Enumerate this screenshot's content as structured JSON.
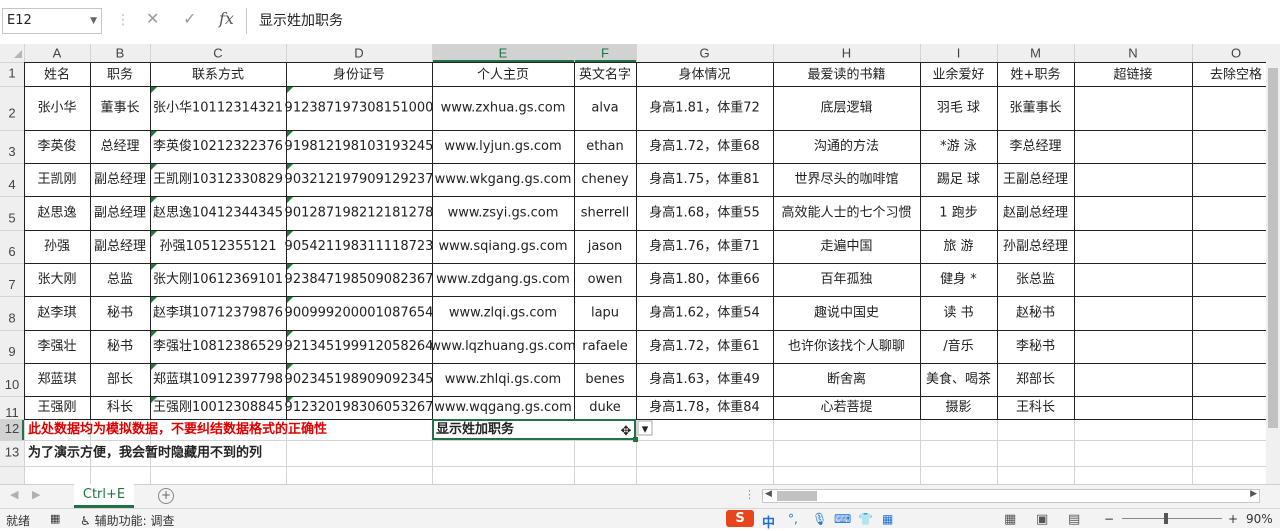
{
  "formula_bar": {
    "name_box": "E12",
    "cancel_symbol": "✕",
    "enter_symbol": "✓",
    "fx_symbol": "fx",
    "formula": "显示姓加职务"
  },
  "columns": [
    "A",
    "B",
    "C",
    "D",
    "E",
    "F",
    "G",
    "H",
    "I",
    "M",
    "N",
    "O"
  ],
  "selected_column": "E",
  "rows": [
    "1",
    "2",
    "3",
    "4",
    "5",
    "6",
    "7",
    "8",
    "9",
    "10",
    "11",
    "12",
    "13"
  ],
  "selected_row": "12",
  "headers": [
    "姓名",
    "职务",
    "联系方式",
    "身份证号",
    "个人主页",
    "英文名字",
    "身体情况",
    "最爱读的书籍",
    "业余爱好",
    "姓+职务",
    "超链接",
    "去除空格"
  ],
  "table_rows": [
    [
      "张小华",
      "董事长",
      "张小华10112314321",
      "912387197308151000",
      "www.zxhua.gs.com",
      "alva",
      "身高1.81，体重72",
      "底层逻辑",
      "羽毛  球",
      "张董事长",
      "",
      ""
    ],
    [
      "李英俊",
      "总经理",
      "李英俊10212322376",
      "919812198103193245",
      "www.lyjun.gs.com",
      "ethan",
      "身高1.72，体重68",
      "沟通的方法",
      "*游 泳",
      "李总经理",
      "",
      ""
    ],
    [
      "王凯刚",
      "副总经理",
      "王凯刚10312330829",
      "903212197909129237",
      "www.wkgang.gs.com",
      "cheney",
      "身高1.75，体重81",
      "世界尽头的咖啡馆",
      "踢足  球",
      "王副总经理",
      "",
      ""
    ],
    [
      "赵思逸",
      "副总经理",
      "赵思逸10412344345",
      "901287198212181278",
      "www.zsyi.gs.com",
      "sherrell",
      "身高1.68，体重55",
      "高效能人士的七个习惯",
      "1 跑步",
      "赵副总经理",
      "",
      ""
    ],
    [
      "孙强",
      "副总经理",
      "孙强10512355121",
      "905421198311118723",
      "www.sqiang.gs.com",
      "jason",
      "身高1.76，体重71",
      "走遍中国",
      "旅    游",
      "孙副总经理",
      "",
      ""
    ],
    [
      "张大刚",
      "总监",
      "张大刚10612369101",
      "923847198509082367",
      "www.zdgang.gs.com",
      "owen",
      "身高1.80，体重66",
      "百年孤独",
      "健身 *",
      "张总监",
      "",
      ""
    ],
    [
      "赵李琪",
      "秘书",
      "赵李琪10712379876",
      "900999200001087654",
      "www.zlqi.gs.com",
      "lapu",
      "身高1.62，体重54",
      "趣说中国史",
      "读 书",
      "赵秘书",
      "",
      ""
    ],
    [
      "李强壮",
      "秘书",
      "李强壮10812386529",
      "921345199912058264",
      "www.lqzhuang.gs.com",
      "rafaele",
      "身高1.72，体重61",
      "也许你该找个人聊聊",
      "/音乐",
      "李秘书",
      "",
      ""
    ],
    [
      "郑蓝琪",
      "部长",
      "郑蓝琪10912397798",
      "902345198909092345",
      "www.zhlqi.gs.com",
      "benes",
      "身高1.63，体重49",
      "断舍离",
      "美食、喝茶",
      "郑部长",
      "",
      ""
    ],
    [
      "王强刚",
      "科长",
      "王强刚10012308845",
      "912320198306053267",
      "www.wqgang.gs.com",
      "duke",
      "身高1.78，体重84",
      "心若菩提",
      "摄影",
      "王科长",
      "",
      ""
    ]
  ],
  "notes": {
    "row12_a": "此处数据均为模拟数据，不要纠结数据格式的正确性",
    "row12_e": "显示姓加职务",
    "row13_a": "为了演示方便，我会暂时隐藏用不到的列"
  },
  "colors": {
    "accent": "#217346",
    "red_note": "#e00000",
    "gridline": "#d4d4d4",
    "header_bg": "#efefef",
    "selected_header_bg": "#d2d2d2"
  },
  "sheet_tabs": [
    "Ctrl+E"
  ],
  "add_sheet_symbol": "+",
  "status_bar": {
    "mode": "就绪",
    "accessibility": "辅助功能: 调查",
    "zoom": "90%",
    "zoom_minus": "−",
    "zoom_plus": "+"
  },
  "ime_toolbar": [
    "中"
  ]
}
